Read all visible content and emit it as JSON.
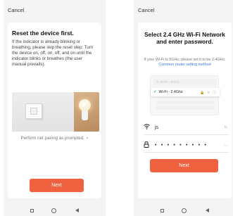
{
  "left_screen": {
    "cancel_label": "Cancel",
    "title": "Reset the device first.",
    "description": "If the indicator is already blinking or breathing, please skip the reset step: Turn the device on, off, on, off, and on until the indicator blinks or breathes (the user manual prevails).",
    "prompt_text": "Perform net pairing as prompted.",
    "prompt_chevron": ">",
    "next_label": "Next"
  },
  "right_screen": {
    "cancel_label": "Cancel",
    "title": "Select 2.4 GHz Wi-Fi Network and enter password.",
    "note_text": "If your Wi-Fi is 5GHz, please set it to be 2.4GHz.",
    "note_link": "Common router setting method",
    "wifi_illustration": {
      "faded_row": "✕ Wi-Fi - 5Ghz",
      "selected_row_check": "✓",
      "selected_row_label": "Wi-Fi - 2.4Ghz",
      "selected_row_icons": "🔒 ᯤ ⓘ"
    },
    "wifi_field": {
      "icon": "wifi-icon",
      "value": "js",
      "right_glyph": "⇆"
    },
    "password_field": {
      "icon": "lock-icon",
      "value": "• • • • • • • • •",
      "right_glyph": "◡"
    },
    "next_label": "Next"
  },
  "colors": {
    "accent": "#f0623f",
    "link": "#3a7ad8",
    "check": "#2fae5a"
  }
}
